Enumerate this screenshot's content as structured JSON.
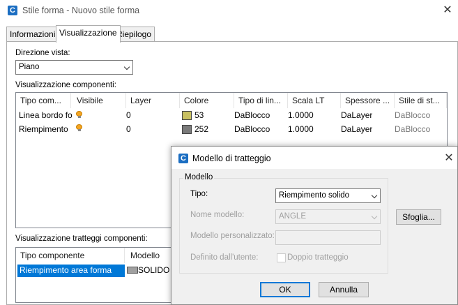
{
  "window": {
    "title": "Stile forma - Nuovo stile forma",
    "close_glyph": "✕",
    "app_icon": "C"
  },
  "tabs": [
    {
      "label": "Informazioni"
    },
    {
      "label": "Visualizzazione"
    },
    {
      "label": "Riepilogo"
    }
  ],
  "view_direction": {
    "label": "Direzione vista:",
    "value": "Piano"
  },
  "components": {
    "label": "Visualizzazione componenti:",
    "columns": [
      "Tipo com...",
      "Visibile",
      "Layer",
      "Colore",
      "Tipo di lin...",
      "Scala LT",
      "Spessore ...",
      "Stile di st..."
    ],
    "rows": [
      {
        "type": "Linea bordo fo",
        "layer": "0",
        "color_num": "53",
        "color_hex": "#c8c060",
        "linetype": "DaBlocco",
        "lt_scale": "1.0000",
        "thickness": "DaLayer",
        "plot_style": "DaBlocco"
      },
      {
        "type": "Riempimento",
        "layer": "0",
        "color_num": "252",
        "color_hex": "#7a7a7a",
        "linetype": "DaBlocco",
        "lt_scale": "1.0000",
        "thickness": "DaLayer",
        "plot_style": "DaBlocco"
      }
    ]
  },
  "hatch": {
    "label": "Visualizzazione tratteggi componenti:",
    "columns": [
      "Tipo componente",
      "Modello"
    ],
    "rows": [
      {
        "type": "Riempimento area forma",
        "pattern": "SOLIDO"
      }
    ],
    "selection_color": "#0078d7"
  },
  "dialog": {
    "title": "Modello di tratteggio",
    "close_glyph": "✕",
    "app_icon": "C",
    "group_label": "Modello",
    "tipo_label": "Tipo:",
    "tipo_value": "Riempimento solido",
    "nome_label": "Nome modello:",
    "nome_value": "ANGLE",
    "personalizzato_label": "Modello personalizzato:",
    "personalizzato_value": "",
    "definito_label": "Definito dall'utente:",
    "doppio_label": "Doppio tratteggio",
    "sfoglia_label": "Sfoglia...",
    "ok_label": "OK",
    "annulla_label": "Annulla"
  }
}
